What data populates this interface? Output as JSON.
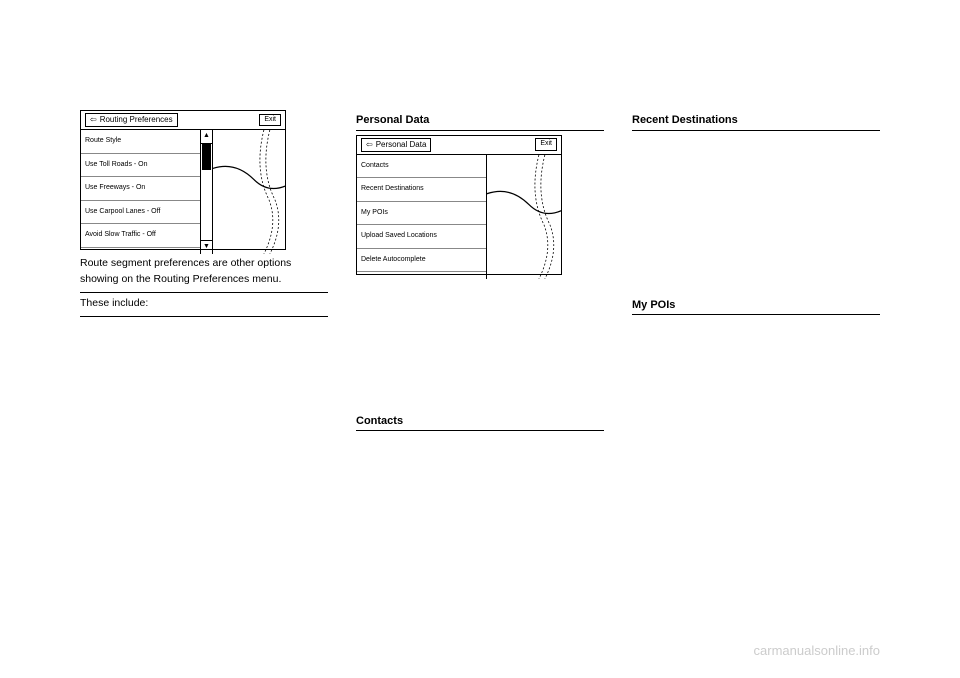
{
  "fig1": {
    "exit": "Exit",
    "title": "Routing Preferences",
    "items": [
      "Route Style",
      "Use Toll Roads - On",
      "Use Freeways - On",
      "Use Carpool Lanes - Off",
      "Avoid Slow Traffic - Off"
    ]
  },
  "col1": {
    "caption": "Route segment preferences are other options showing on the Routing Preferences menu.",
    "theseInclude": "These include:"
  },
  "fig2": {
    "exit": "Exit",
    "title": "Personal Data",
    "items": [
      "Contacts",
      "Recent Destinations",
      "My POIs",
      "Upload Saved Locations",
      "Delete Autocomplete"
    ]
  },
  "headings": {
    "personalData": "Personal Data",
    "contacts": "Contacts",
    "recentDest": "Recent Destinations",
    "myPOIs": "My POIs"
  },
  "watermark": "carmanualsonline.info"
}
